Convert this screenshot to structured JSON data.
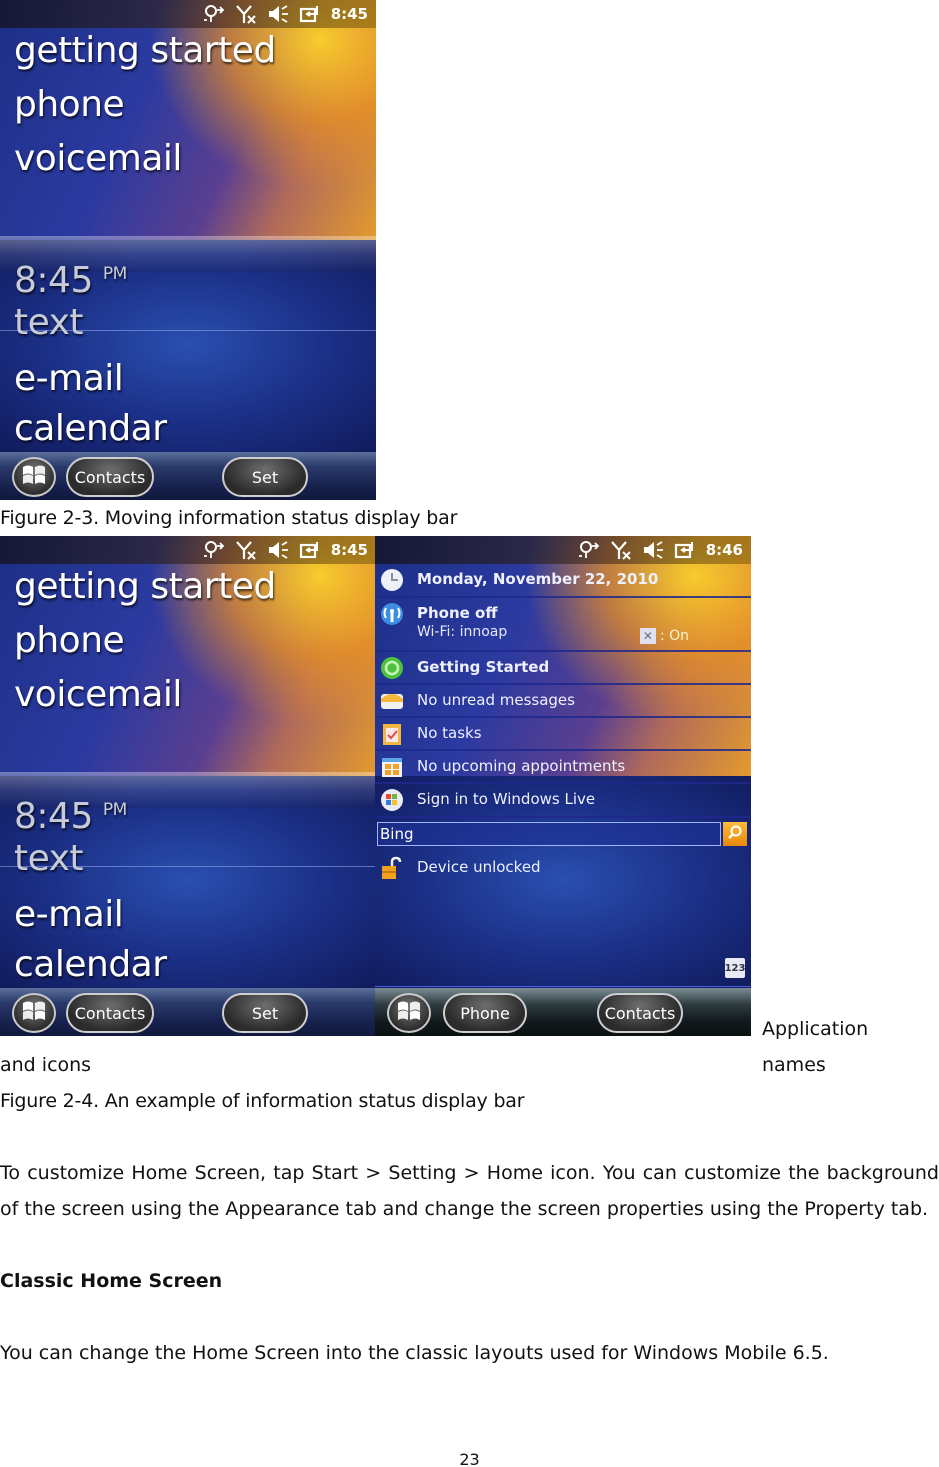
{
  "phone_common": {
    "status_icons": [
      "connectivity-icon",
      "signal-off-icon",
      "sound-icon",
      "battery-charging-icon"
    ],
    "start_button_icon": "windows-flag-icon"
  },
  "figure_2_3": {
    "status_time": "8:45",
    "top_items": [
      "getting started",
      "phone",
      "voicemail"
    ],
    "clock_time": "8:45",
    "clock_ampm": "PM",
    "focused_item": "text",
    "bottom_items": [
      "e-mail",
      "calendar"
    ],
    "softkeys": {
      "left": "Contacts",
      "right": "Set"
    },
    "caption": "Figure 2-3. Moving information status display bar"
  },
  "figure_2_4": {
    "left_screen": {
      "status_time": "8:45",
      "top_items": [
        "getting started",
        "phone",
        "voicemail"
      ],
      "clock_time": "8:45",
      "clock_ampm": "PM",
      "focused_item": "text",
      "bottom_items": [
        "e-mail",
        "calendar"
      ],
      "softkeys": {
        "left": "Contacts",
        "right": "Set"
      }
    },
    "right_screen": {
      "status_time": "8:46",
      "rows": [
        {
          "icon": "clock-icon",
          "text": "Monday, November 22, 2010",
          "bold": true
        },
        {
          "icon": "phone-signal-icon",
          "text": "Phone off",
          "sub": "Wi-Fi: innoap",
          "toggle_label": ": On",
          "bold": true
        },
        {
          "icon": "getting-started-icon",
          "text": "Getting Started",
          "bold": true
        },
        {
          "icon": "envelope-icon",
          "text": "No unread messages"
        },
        {
          "icon": "tasks-icon",
          "text": "No tasks"
        },
        {
          "icon": "calendar-icon",
          "text": "No upcoming appointments"
        },
        {
          "icon": "windows-live-icon",
          "text": "Sign in to Windows Live"
        }
      ],
      "search": {
        "value": "Bing",
        "button_icon": "search-icon"
      },
      "lock_row": {
        "icon": "unlock-icon",
        "text": "Device unlocked"
      },
      "keyboard_icon_label": "123",
      "softkeys": {
        "left": "Phone",
        "right": "Contacts"
      }
    },
    "side_label_part1": "Application  names",
    "side_label_part2": "and icons",
    "caption": "Figure 2-4. An example of information status display bar"
  },
  "body": {
    "paragraph_1": "To customize Home Screen, tap Start > Setting > Home icon. You can customize the background of the screen using the Appearance tab and change the screen properties using the Property tab.",
    "heading": "Classic Home Screen",
    "paragraph_2": "You can change the Home Screen into the classic layouts used for Windows Mobile 6.5."
  },
  "page_number": "23"
}
